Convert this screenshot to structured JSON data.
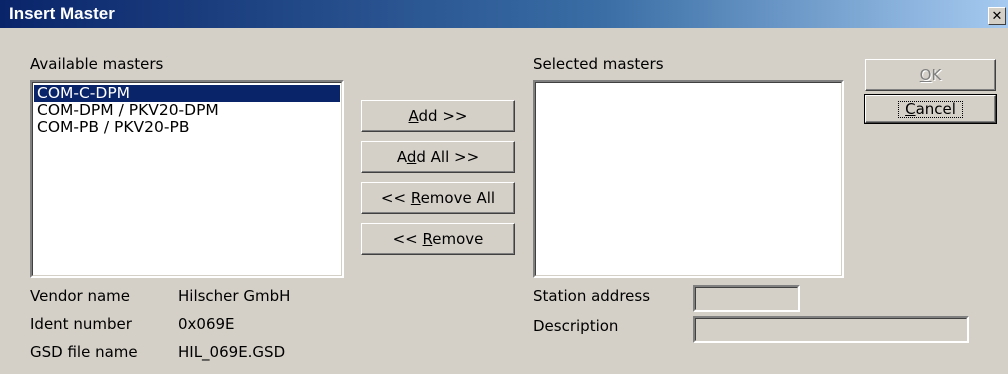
{
  "window": {
    "title": "Insert Master",
    "close_glyph": "✕"
  },
  "available": {
    "label": "Available masters",
    "items": [
      "COM-C-DPM",
      "COM-DPM / PKV20-DPM",
      "COM-PB / PKV20-PB"
    ],
    "selected_index": 0
  },
  "selected": {
    "label": "Selected masters",
    "items": []
  },
  "buttons": {
    "add": {
      "pre": "",
      "mn": "A",
      "post": "dd >>"
    },
    "add_all": {
      "pre": "A",
      "mn": "d",
      "post": "d All >>"
    },
    "remove_all": {
      "pre": "<< ",
      "mn": "R",
      "post": "emove All"
    },
    "remove": {
      "pre": "<< ",
      "mn": "R",
      "post": "emove"
    },
    "ok": {
      "pre": "",
      "mn": "O",
      "post": "K"
    },
    "cancel": {
      "pre": "",
      "mn": "C",
      "post": "ancel"
    }
  },
  "info": {
    "vendor_label": "Vendor name",
    "vendor_value": "Hilscher GmbH",
    "ident_label": "Ident number",
    "ident_value": "0x069E",
    "gsd_label": "GSD file name",
    "gsd_value": "HIL_069E.GSD"
  },
  "station": {
    "label": "Station address",
    "value": ""
  },
  "description": {
    "label": "Description",
    "value": ""
  }
}
